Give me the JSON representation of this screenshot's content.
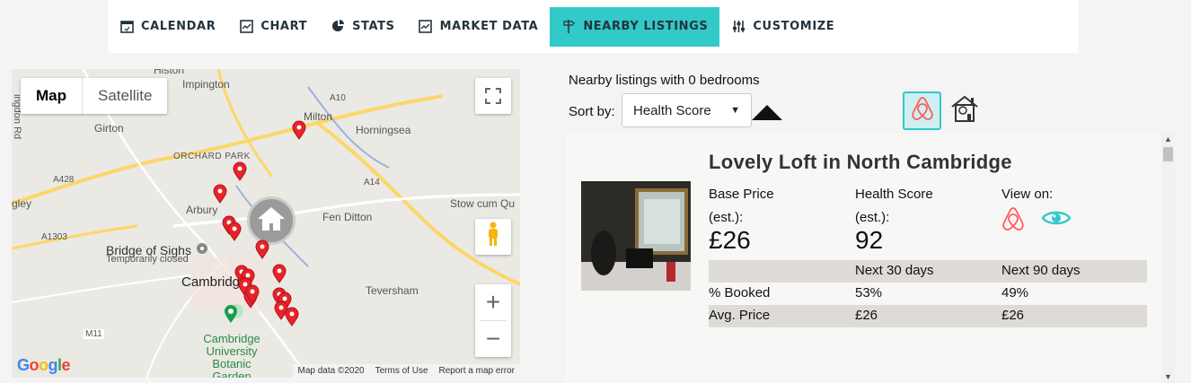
{
  "nav": {
    "tabs": [
      {
        "label": "CALENDAR",
        "icon": "calendar-icon"
      },
      {
        "label": "CHART",
        "icon": "line-chart-icon"
      },
      {
        "label": "STATS",
        "icon": "pie-chart-icon"
      },
      {
        "label": "MARKET DATA",
        "icon": "market-chart-icon"
      },
      {
        "label": "NEARBY LISTINGS",
        "icon": "signpost-icon"
      },
      {
        "label": "CUSTOMIZE",
        "icon": "sliders-icon"
      }
    ],
    "active_tab": "NEARBY LISTINGS",
    "accent_color": "#32c9c9"
  },
  "map": {
    "type_toggle": {
      "map": "Map",
      "satellite": "Satellite"
    },
    "selected_type": "Map",
    "labels": {
      "histon": "Histon",
      "impington": "Impington",
      "milton": "Milton",
      "girton": "Girton",
      "horningsea": "Horningsea",
      "orchard_park": "ORCHARD PARK",
      "a10": "A10",
      "a428": "A428",
      "a14": "A14",
      "gley": "gley",
      "arbury": "Arbury",
      "fen_ditton": "Fen Ditton",
      "stow_cum_quy": "Stow cum Qu",
      "a1303": "A1303",
      "bridge_of_sighs": "Bridge of Sighs",
      "temporarily_closed": "Temporarily closed",
      "cambridge": "Cambridge",
      "teversham": "Teversham",
      "m11": "M11",
      "botanic": "Cambridge University Botanic Garden",
      "road": "ingdon Rd"
    },
    "footer": {
      "data": "Map data ©2020",
      "terms": "Terms of Use",
      "report": "Report a map error"
    },
    "google": "Google",
    "zoom_in": "+",
    "zoom_out": "−"
  },
  "listings_panel": {
    "heading": "Nearby listings with 0 bedrooms",
    "sort_label": "Sort by:",
    "sort_value": "Health Score",
    "listing": {
      "title": "Lovely Loft in North Cambridge",
      "base_price_label_1": "Base Price",
      "base_price_label_2": "(est.):",
      "base_price": "£26",
      "health_label_1": "Health Score",
      "health_label_2": "(est.):",
      "health_score": "92",
      "view_on_label": "View on:",
      "table": {
        "headers": [
          "",
          "Next 30 days",
          "Next 90 days"
        ],
        "rows": [
          {
            "label": "% Booked",
            "d30": "53%",
            "d90": "49%"
          },
          {
            "label": "Avg. Price",
            "d30": "£26",
            "d90": "£26"
          }
        ]
      }
    }
  }
}
